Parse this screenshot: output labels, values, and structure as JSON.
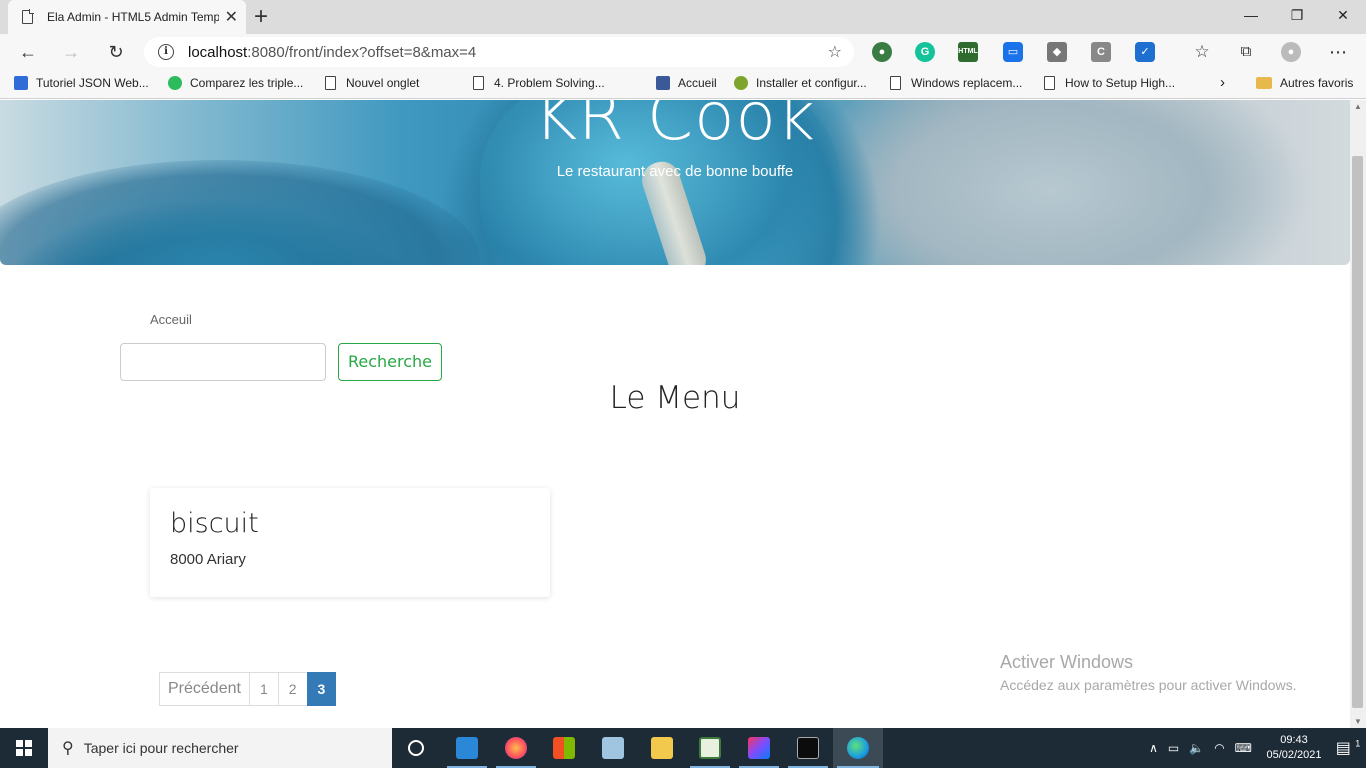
{
  "browser": {
    "tab_title": "Ela Admin - HTML5 Admin Temp",
    "url_host": "localhost",
    "url_rest": ":8080/front/index?offset=8&max=4",
    "bookmarks": [
      "Tutoriel JSON Web...",
      "Comparez les triple...",
      "Nouvel onglet",
      "4. Problem Solving...",
      "Accueil",
      "Installer et configur...",
      "Windows replacem...",
      "How to Setup High...",
      "Autres favoris"
    ]
  },
  "hero": {
    "brand": "KR Cook",
    "tagline": "Le restaurant avec de bonne bouffe"
  },
  "breadcrumb": "Acceuil",
  "search": {
    "value": "",
    "button_label": "Recherche"
  },
  "menu_title": "Le Menu",
  "items": [
    {
      "name": "biscuit",
      "price": "8000 Ariary"
    }
  ],
  "pagination": {
    "prev": "Précédent",
    "pages": [
      "1",
      "2",
      "3"
    ],
    "current": "3"
  },
  "watermark": {
    "title": "Activer Windows",
    "subtitle": "Accédez aux paramètres pour activer Windows."
  },
  "taskbar": {
    "search_placeholder": "Taper ici pour rechercher",
    "time": "09:43",
    "date": "05/02/2021",
    "notifications": "1"
  }
}
